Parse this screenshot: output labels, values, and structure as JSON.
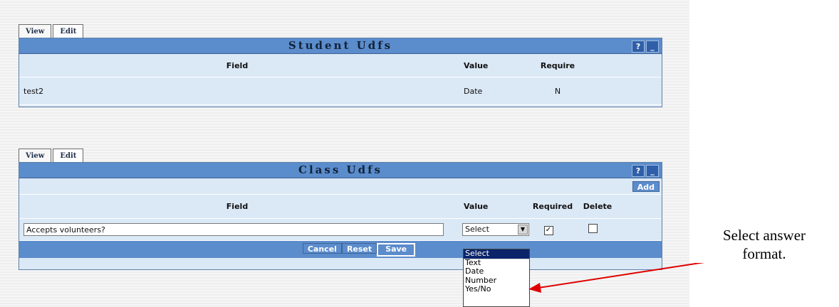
{
  "student_panel": {
    "tabs": [
      "View",
      "Edit"
    ],
    "title": "Student Udfs",
    "help_label": "?",
    "minimize_label": "_",
    "columns": {
      "field": "Field",
      "value": "Value",
      "require": "Require"
    },
    "rows": [
      {
        "field": "test2",
        "value": "Date",
        "require": "N"
      }
    ]
  },
  "class_panel": {
    "tabs": [
      "View",
      "Edit"
    ],
    "title": "Class Udfs",
    "help_label": "?",
    "minimize_label": "_",
    "add_label": "Add",
    "columns": {
      "field": "Field",
      "value": "Value",
      "required": "Required",
      "delete": "Delete"
    },
    "row": {
      "field_value": "Accepts volunteers?",
      "value_select": "Select",
      "required_mark": "✓",
      "delete_mark": ""
    },
    "buttons": {
      "cancel": "Cancel",
      "reset": "Reset",
      "save": "Save"
    },
    "dropdown_options": [
      "Select",
      "Text",
      "Date",
      "Number",
      "Yes/No"
    ]
  },
  "annotation": {
    "line1": "Select answer",
    "line2": "format.",
    "arrow_color": "#e00000"
  }
}
